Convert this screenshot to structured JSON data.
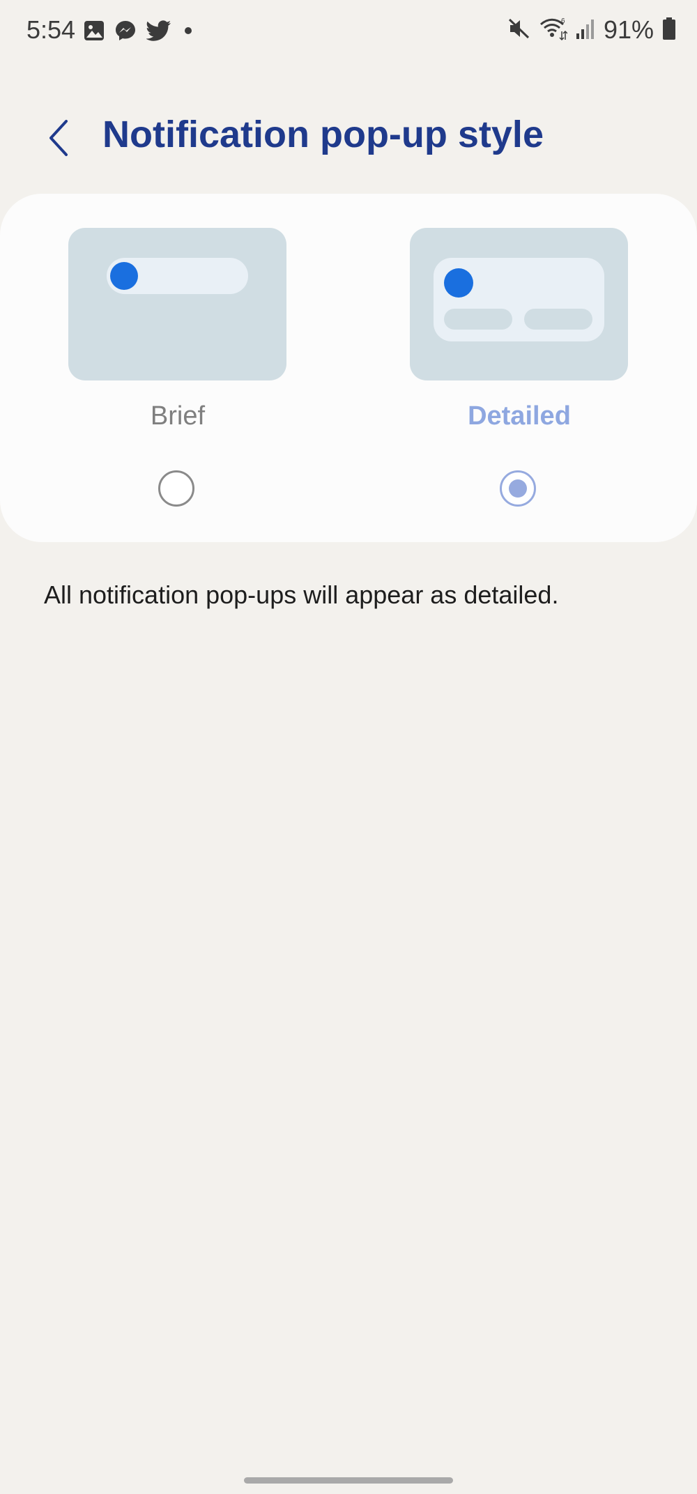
{
  "status_bar": {
    "time": "5:54",
    "battery_percent": "91%",
    "left_icons": [
      "gallery-icon",
      "messenger-icon",
      "twitter-icon",
      "dot-icon"
    ],
    "right_icons": [
      "mute-icon",
      "wifi-icon",
      "signal-icon",
      "battery-icon"
    ]
  },
  "header": {
    "title": "Notification pop-up style",
    "back_icon": "chevron-left-icon"
  },
  "options": [
    {
      "label": "Brief",
      "selected": false
    },
    {
      "label": "Detailed",
      "selected": true
    }
  ],
  "description": "All notification pop-ups will appear as detailed.",
  "colors": {
    "background": "#f3f1ed",
    "card": "#fcfcfc",
    "title": "#1f3a8c",
    "accent": "#1a6fdf",
    "selected": "#96aadf",
    "preview": "#d0dde3"
  }
}
